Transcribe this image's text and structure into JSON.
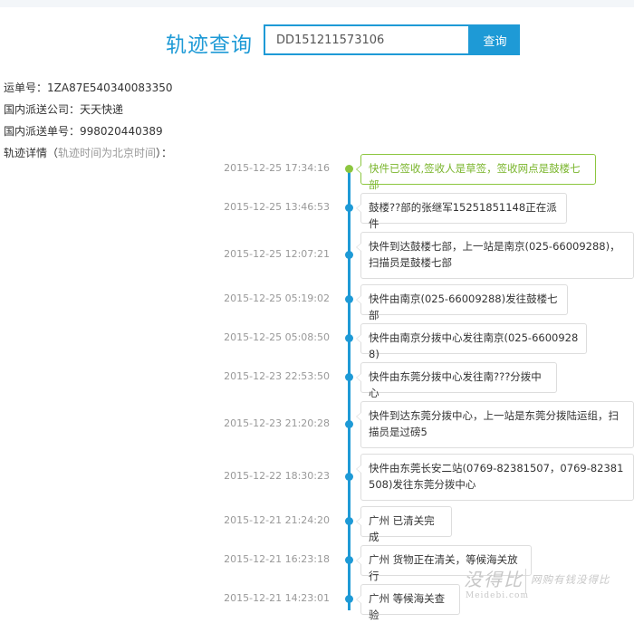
{
  "search": {
    "title": "轨迹查询",
    "input_value": "DD151211573106",
    "button_label": "查询"
  },
  "info": {
    "waybill": "运单号：1ZA87E540340083350",
    "domestic_company": "国内派送公司：天天快递",
    "domestic_number": "国内派送单号：998020440389",
    "details_prefix": "轨迹详情（",
    "details_note": "轨迹时间为北京时间",
    "details_suffix": "）："
  },
  "events": [
    {
      "time": "2015-12-25 17:34:16",
      "text": "快件已签收,签收人是草签，签收网点是鼓楼七部",
      "status": "latest"
    },
    {
      "time": "2015-12-25 13:46:53",
      "text": "鼓楼??部的张继军15251851148正在派件",
      "status": "normal"
    },
    {
      "time": "2015-12-25 12:07:21",
      "text": "快件到达鼓楼七部，上一站是南京(025-66009288)，扫描员是鼓楼七部",
      "status": "normal"
    },
    {
      "time": "2015-12-25 05:19:02",
      "text": "快件由南京(025-66009288)发往鼓楼七部",
      "status": "normal"
    },
    {
      "time": "2015-12-25 05:08:50",
      "text": "快件由南京分拨中心发往南京(025-66009288)",
      "status": "normal"
    },
    {
      "time": "2015-12-23 22:53:50",
      "text": "快件由东莞分拨中心发往南???分拨中心",
      "status": "normal"
    },
    {
      "time": "2015-12-23 21:20:28",
      "text": "快件到达东莞分拨中心，上一站是东莞分拨陆运组，扫描员是过磅5",
      "status": "normal"
    },
    {
      "time": "2015-12-22 18:30:23",
      "text": "快件由东莞长安二站(0769-82381507，0769-82381508)发往东莞分拨中心",
      "status": "normal"
    },
    {
      "time": "2015-12-21 21:24:20",
      "text": "广州 已清关完成",
      "status": "normal"
    },
    {
      "time": "2015-12-21 16:23:18",
      "text": "广州 货物正在清关，等候海关放行",
      "status": "normal"
    },
    {
      "time": "2015-12-21 14:23:01",
      "text": "广州 等候海关查验",
      "status": "normal"
    }
  ],
  "watermark": {
    "brand": "没得比",
    "url": "Meidebi.com",
    "slogan": "网购有钱没得比"
  }
}
